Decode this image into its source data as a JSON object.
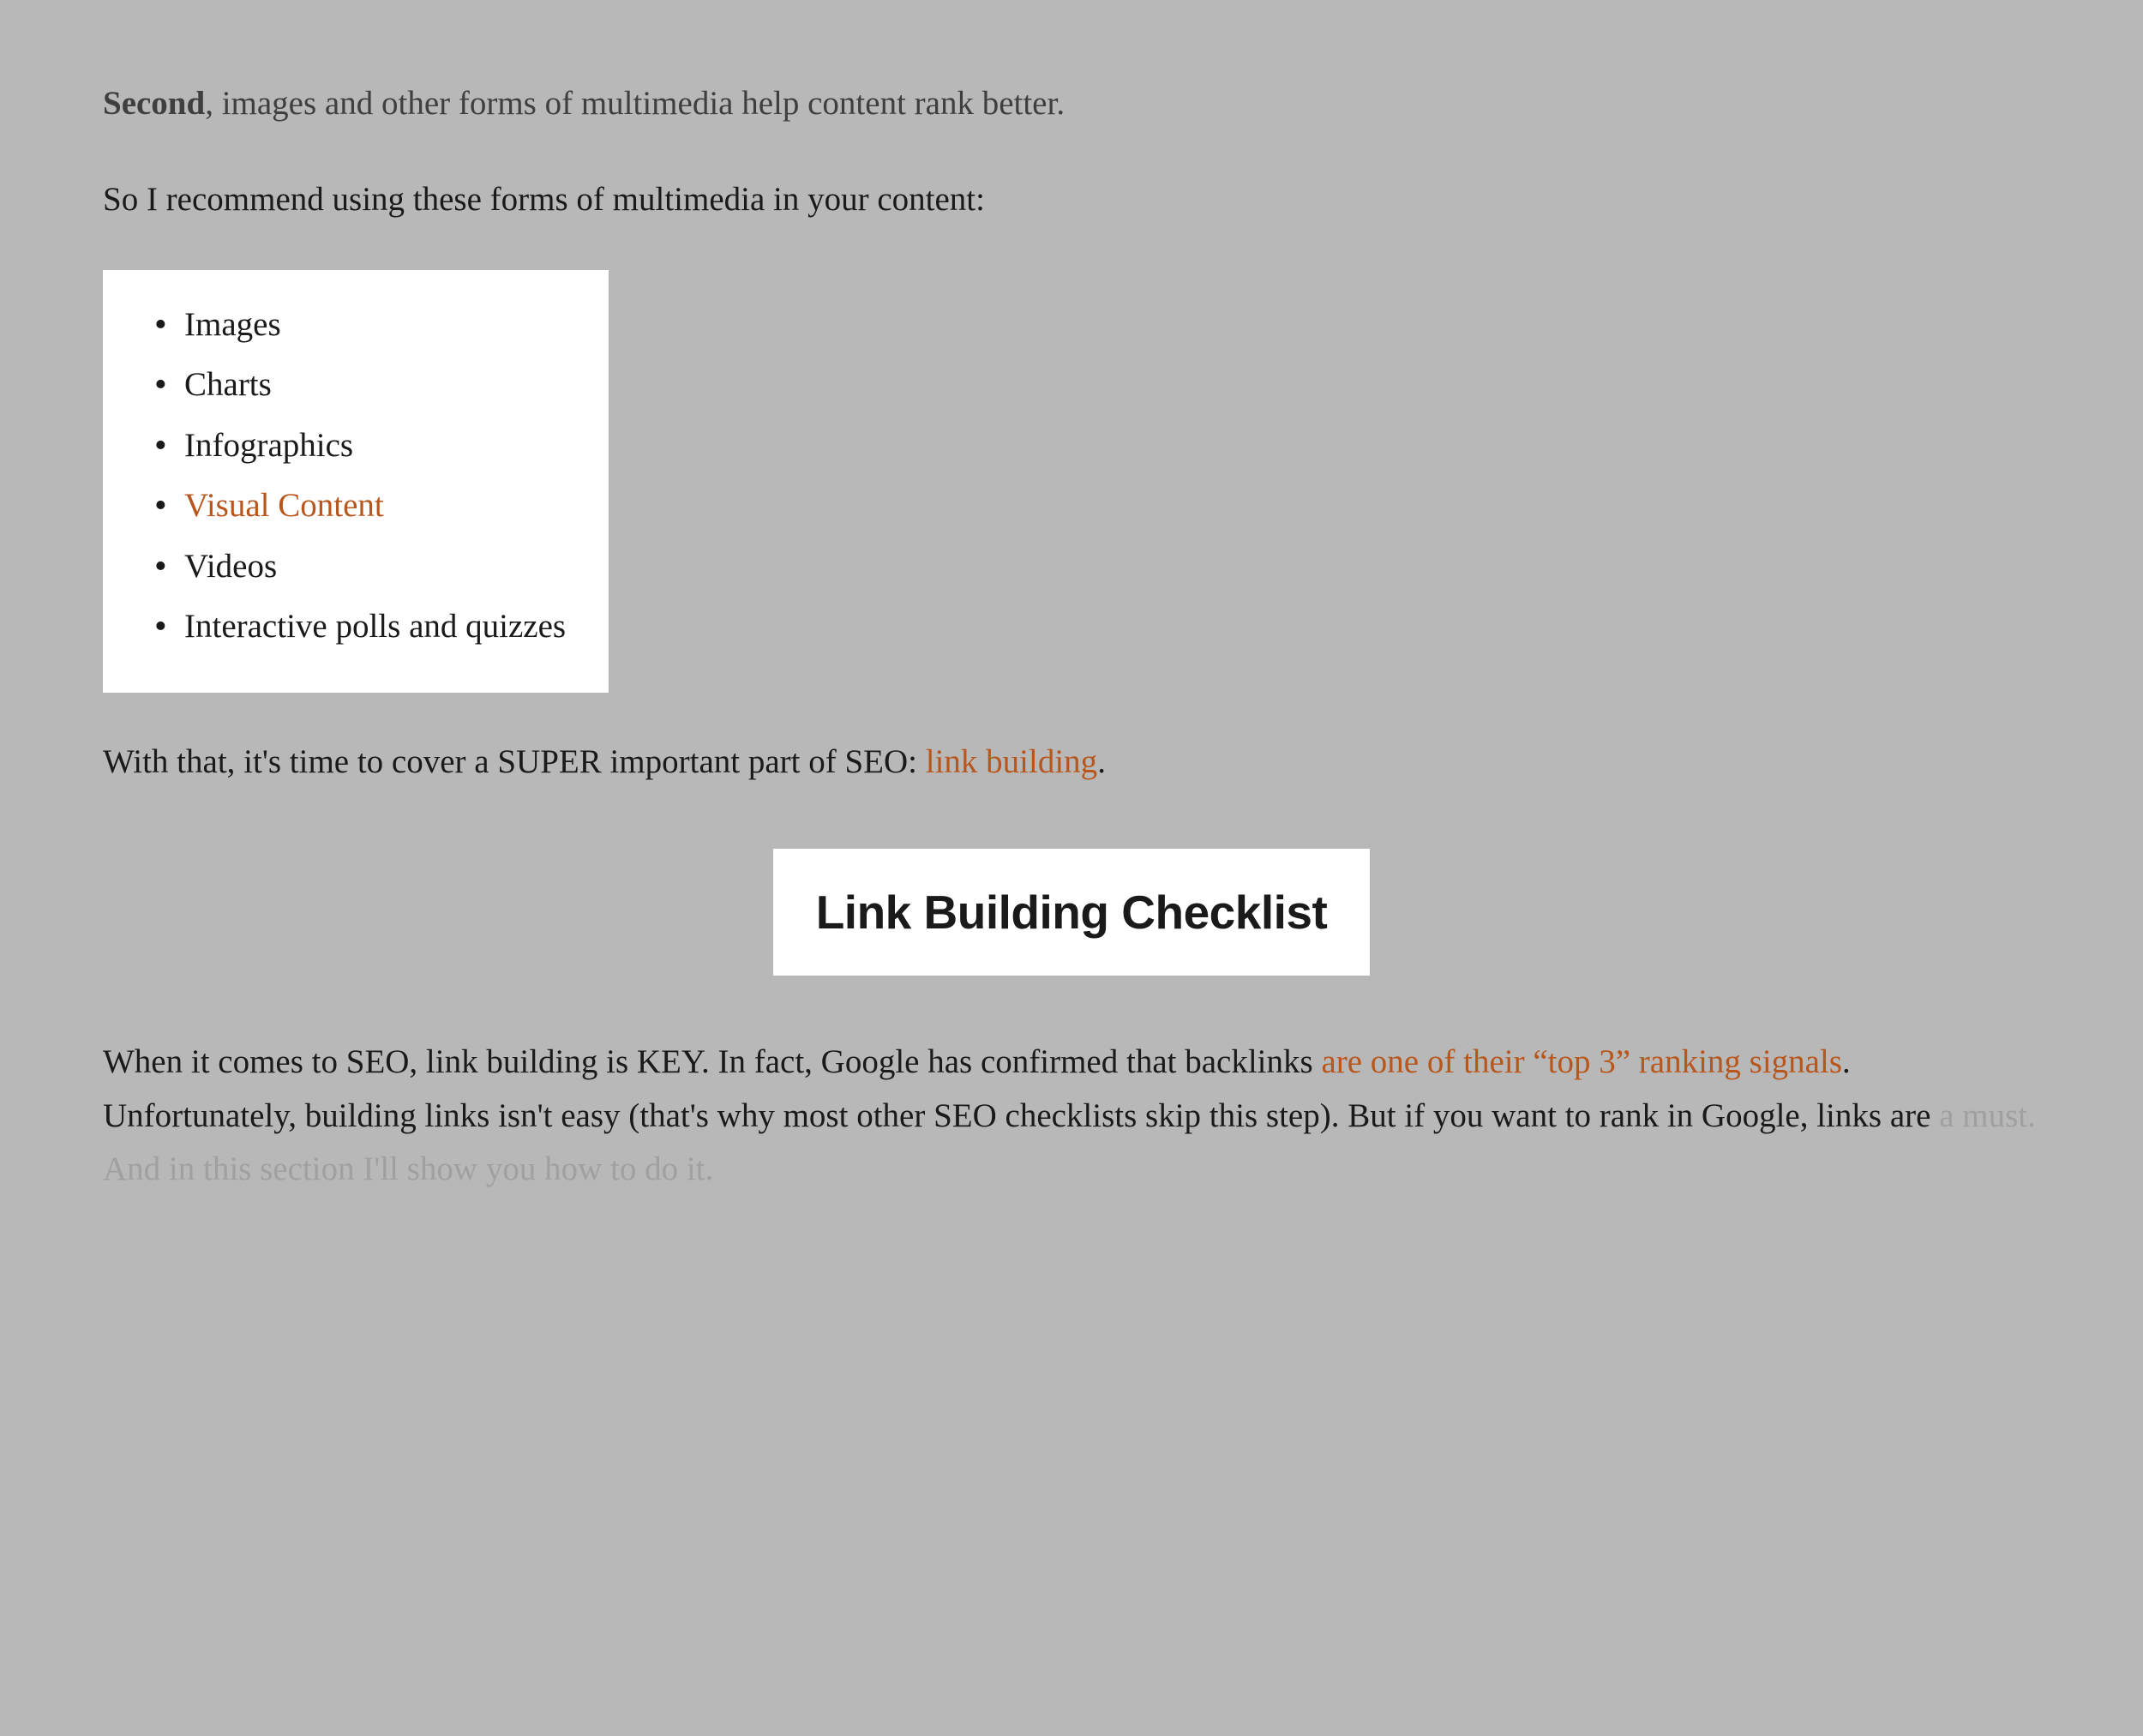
{
  "p1": {
    "bold": "Second",
    "rest": ", images and other forms of multimedia help content rank better."
  },
  "p2": "So I recommend using these forms of multimedia in your content:",
  "list": {
    "items": [
      {
        "text": "Images",
        "is_link": false
      },
      {
        "text": "Charts",
        "is_link": false
      },
      {
        "text": "Infographics",
        "is_link": false
      },
      {
        "text": "Visual Content",
        "is_link": true
      },
      {
        "text": "Videos",
        "is_link": false
      },
      {
        "text": "Interactive polls and quizzes",
        "is_link": false
      }
    ]
  },
  "p3": {
    "before": "With that, it's time to cover a SUPER important part of SEO: ",
    "link": "link building",
    "after": "."
  },
  "heading": "Link Building Checklist",
  "p4": {
    "part1": "When it comes to SEO, link building is KEY. In fact, Google has confirmed that backlinks ",
    "link": "are one of their “top 3” ranking signals",
    "part2": ". Unfortunately, building links isn't easy (that's why most other SEO checklists skip this step). But if you want to rank in Google, links are ",
    "fade": "a must. And in this section I'll show you how to do it."
  }
}
